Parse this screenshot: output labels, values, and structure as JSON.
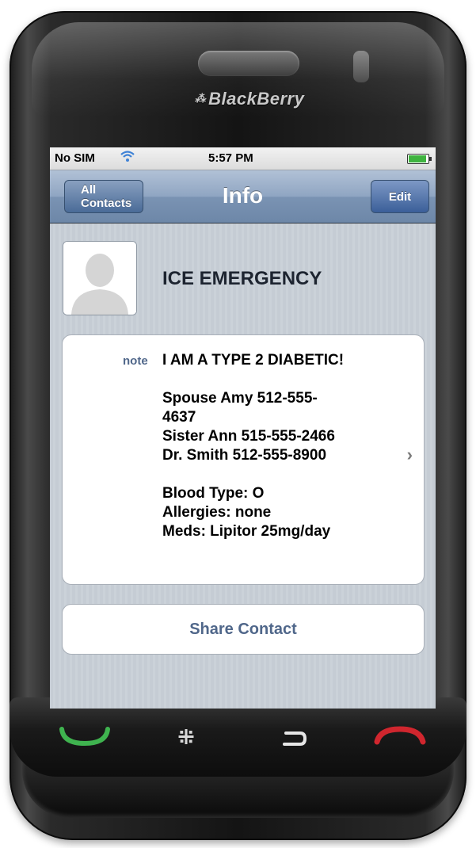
{
  "device": {
    "brand": "BlackBerry",
    "buttons": {
      "call": "call-icon",
      "menu": "blackberry-menu-icon",
      "back": "back-icon",
      "end": "end-call-icon"
    },
    "colors": {
      "call": "#3fb34f",
      "end": "#d0262e"
    }
  },
  "status_bar": {
    "carrier": "No SIM",
    "wifi_icon": "wifi-icon",
    "time": "5:57 PM",
    "battery_icon": "battery-icon"
  },
  "nav_bar": {
    "back_label": "All Contacts",
    "title": "Info",
    "edit_label": "Edit"
  },
  "contact": {
    "name": "ICE EMERGENCY",
    "avatar_icon": "person-silhouette-icon"
  },
  "note": {
    "label": "note",
    "lines": [
      "I AM A TYPE 2 DIABETIC!",
      "",
      "Spouse Amy 512-555-",
      "4637",
      "Sister Ann 515-555-2466",
      "Dr. Smith 512-555-8900",
      "",
      "Blood Type: O",
      "Allergies: none",
      "Meds: Lipitor 25mg/day"
    ]
  },
  "actions": {
    "share_label": "Share Contact"
  }
}
